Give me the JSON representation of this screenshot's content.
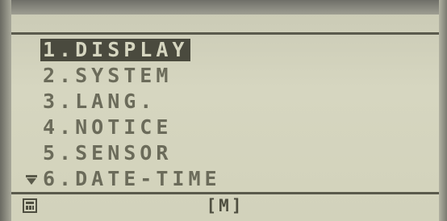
{
  "menu": {
    "items": [
      {
        "label": "1.DISPLAY",
        "selected": true
      },
      {
        "label": "2.SYSTEM",
        "selected": false
      },
      {
        "label": "3.LANG.",
        "selected": false
      },
      {
        "label": "4.NOTICE",
        "selected": false
      },
      {
        "label": "5.SENSOR",
        "selected": false
      },
      {
        "label": "6.DATE-TIME",
        "selected": false
      }
    ]
  },
  "status_bar": {
    "mode_label": "[M]",
    "left_icon": "memory-card-icon"
  },
  "indicators": {
    "scroll_down_icon": "scroll-down-arrow-icon"
  },
  "colors": {
    "lcd_background": "#d2d2bb",
    "lcd_text": "#6b6b5a",
    "highlight_background": "#4a4a3e",
    "highlight_text": "#d6d6c0"
  }
}
